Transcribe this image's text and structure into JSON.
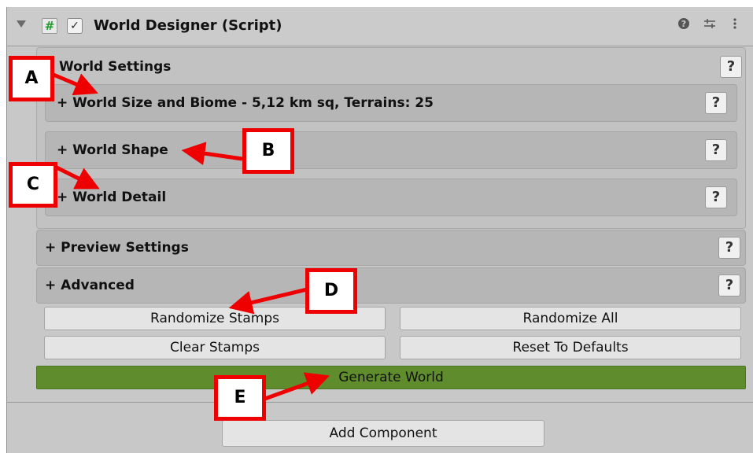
{
  "component": {
    "title": "World Designer (Script)",
    "script_glyph": "#",
    "check_glyph": "✓",
    "icons": {
      "help": "question-circle-icon",
      "presets": "sliders-icon",
      "menu": "kebab-menu-icon"
    },
    "help_glyph": "?"
  },
  "world_settings": {
    "label": "World Settings",
    "sections": [
      {
        "label": "+ World Size and Biome - 5,12 km sq, Terrains: 25"
      },
      {
        "label": "+ World Shape"
      },
      {
        "label": "+ World Detail"
      }
    ]
  },
  "preview_settings": {
    "label": "+ Preview Settings"
  },
  "advanced": {
    "label": "+ Advanced"
  },
  "buttons": {
    "randomize_stamps": "Randomize Stamps",
    "randomize_all": "Randomize All",
    "clear_stamps": "Clear Stamps",
    "reset_defaults": "Reset To Defaults",
    "generate_world": "Generate World",
    "add_component": "Add Component"
  },
  "colors": {
    "generate_green": "#5f8c2c",
    "callout_red": "#ee0000"
  },
  "callouts": {
    "a": "A",
    "b": "B",
    "c": "C",
    "d": "D",
    "e": "E"
  }
}
